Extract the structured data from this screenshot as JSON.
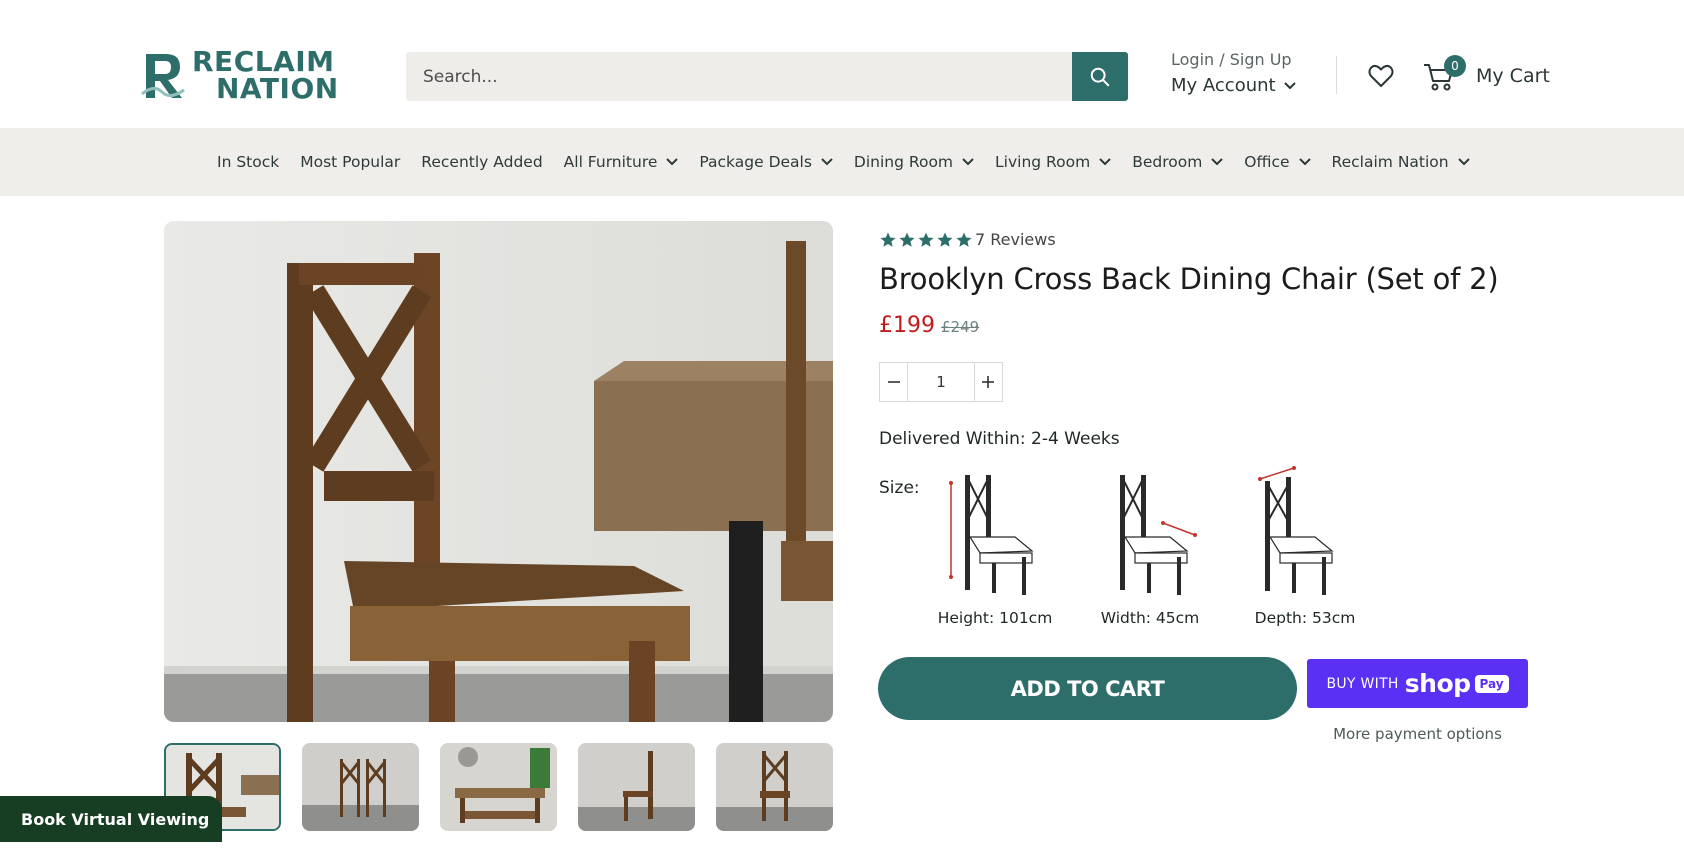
{
  "brand": {
    "logo_line1": "RECLAIM",
    "logo_line2": "NATION",
    "brand_color": "#2d6e6a"
  },
  "header": {
    "search_placeholder": "Search...",
    "login_label": "Login / Sign Up",
    "account_label": "My Account",
    "cart_label": "My Cart",
    "cart_count": "0"
  },
  "nav": {
    "items": [
      {
        "label": "In Stock",
        "has_dropdown": false
      },
      {
        "label": "Most Popular",
        "has_dropdown": false
      },
      {
        "label": "Recently Added",
        "has_dropdown": false
      },
      {
        "label": "All Furniture",
        "has_dropdown": true
      },
      {
        "label": "Package Deals",
        "has_dropdown": true
      },
      {
        "label": "Dining Room",
        "has_dropdown": true
      },
      {
        "label": "Living Room",
        "has_dropdown": true
      },
      {
        "label": "Bedroom",
        "has_dropdown": true
      },
      {
        "label": "Office",
        "has_dropdown": true
      },
      {
        "label": "Reclaim Nation",
        "has_dropdown": true
      }
    ]
  },
  "product": {
    "rating_stars": 5,
    "reviews_label": "7 Reviews",
    "title": "Brooklyn Cross Back Dining Chair (Set of 2)",
    "price_now": "£199",
    "price_was": "£249",
    "quantity": "1",
    "delivery": "Delivered Within: 2-4 Weeks",
    "size_label": "Size:",
    "dimensions": [
      {
        "label": "Height: 101cm",
        "icon": "chair-height-diagram-icon"
      },
      {
        "label": "Width: 45cm",
        "icon": "chair-width-diagram-icon"
      },
      {
        "label": "Depth: 53cm",
        "icon": "chair-depth-diagram-icon"
      }
    ],
    "add_to_cart_label": "ADD TO CART",
    "shop_pay": {
      "buy_with": "BUY WITH",
      "shop": "shop",
      "pay": "Pay"
    },
    "more_payment_label": "More payment options",
    "price_color": "#c21b1b",
    "shop_pay_color": "#5a31f4"
  },
  "gallery": {
    "thumbnail_count": 5,
    "active_index": 0
  },
  "virtual_viewing": {
    "label": "Book Virtual Viewing"
  }
}
